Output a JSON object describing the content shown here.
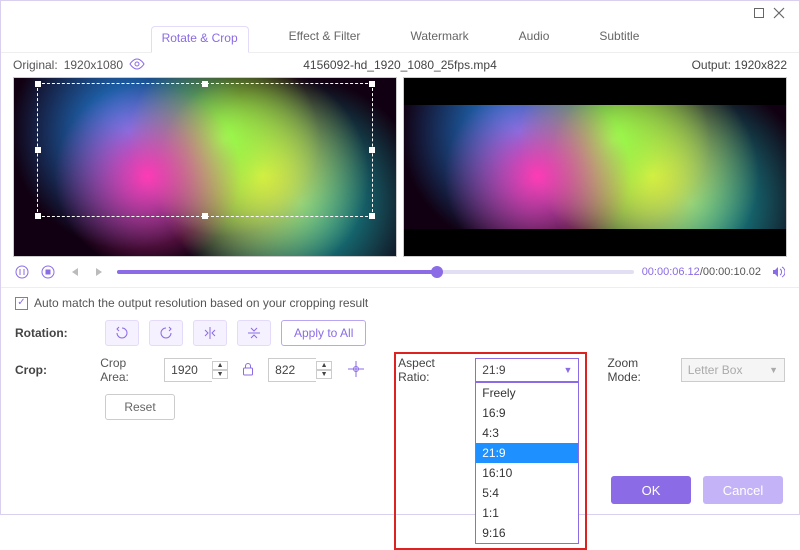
{
  "tabs": {
    "rotate_crop": "Rotate & Crop",
    "effect_filter": "Effect & Filter",
    "watermark": "Watermark",
    "audio": "Audio",
    "subtitle": "Subtitle"
  },
  "info": {
    "original_label": "Original:",
    "original_dim": "1920x1080",
    "filename": "4156092-hd_1920_1080_25fps.mp4",
    "output_label": "Output:",
    "output_dim": "1920x822"
  },
  "time": {
    "current": "00:00:06.12",
    "duration": "00:00:10.02"
  },
  "auto_match_label": "Auto match the output resolution based on your cropping result",
  "rotation_label": "Rotation:",
  "apply_all_label": "Apply to All",
  "crop_label": "Crop:",
  "crop_area_label": "Crop Area:",
  "crop_w": "1920",
  "crop_h": "822",
  "reset_label": "Reset",
  "aspect_label": "Aspect Ratio:",
  "aspect_selected": "21:9",
  "aspect_options": [
    "Freely",
    "16:9",
    "4:3",
    "21:9",
    "16:10",
    "5:4",
    "1:1",
    "9:16"
  ],
  "zoom_label": "Zoom Mode:",
  "zoom_value": "Letter Box",
  "buttons": {
    "ok": "OK",
    "cancel": "Cancel"
  }
}
